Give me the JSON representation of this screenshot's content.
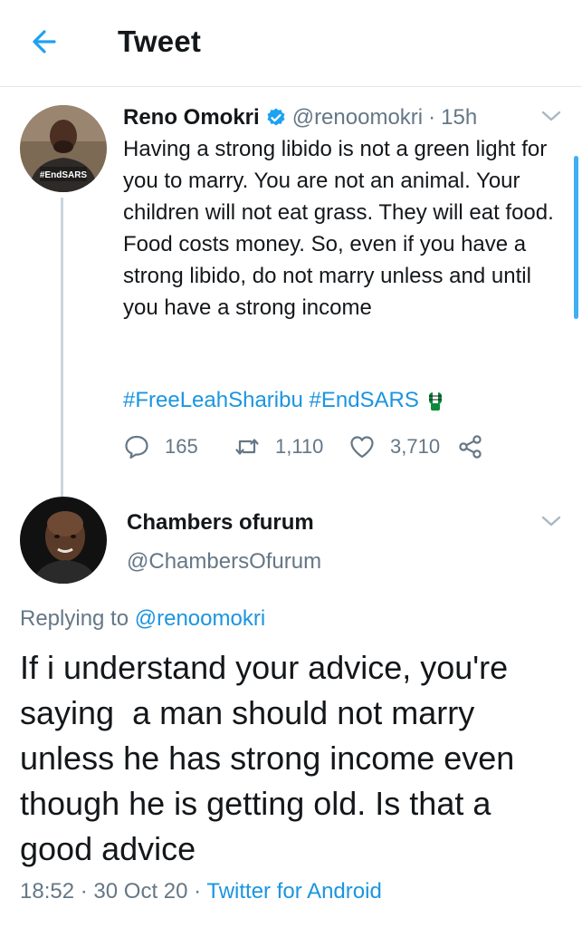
{
  "header": {
    "title": "Tweet"
  },
  "tweet": {
    "author_name": "Reno Omokri",
    "author_handle": "@renoomokri",
    "separator": "·",
    "time": "15h",
    "body": "Having a strong libido is not a green light for you to marry. You are not an animal. Your children will not eat grass. They will eat food. Food costs money. So, even if you have a strong libido, do not marry unless and until you have a strong income",
    "hashtags": [
      "#FreeLeahSharibu",
      "#EndSARS"
    ],
    "avatar_text": "#EndSARS",
    "replies": "165",
    "retweets": "1,110",
    "likes": "3,710"
  },
  "reply": {
    "author_name": "Chambers ofurum",
    "author_handle": "@ChambersOfurum",
    "replying_prefix": "Replying to",
    "replying_to": "@renoomokri",
    "body": "If i understand your advice, you're saying  a man should not marry unless he has strong income even though he is getting old. Is that a good advice",
    "time": "18:52",
    "date": "30 Oct 20",
    "separator": "·",
    "source": "Twitter for Android"
  },
  "colors": {
    "accent": "#1da1f2",
    "link": "#1b95e0",
    "muted": "#657786",
    "text": "#14171a"
  },
  "icons": {
    "back": "arrow-left-icon",
    "verified": "verified-badge-icon",
    "chevron": "chevron-down-icon",
    "reply": "reply-bubble-icon",
    "retweet": "retweet-icon",
    "like": "heart-icon",
    "share": "share-icon",
    "fist": "raised-fist-emoji"
  }
}
